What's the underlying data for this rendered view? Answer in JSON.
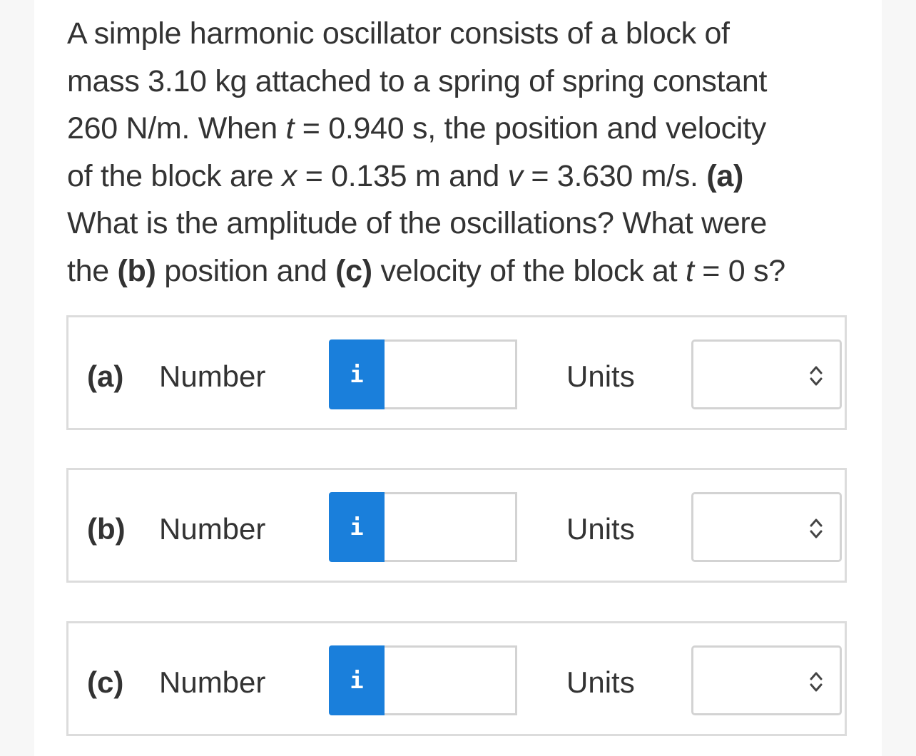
{
  "question": {
    "l1": "A simple harmonic oscillator consists of a block of",
    "l2": "mass 3.10 kg attached to a spring of spring constant",
    "l3a": "260 N/m. When ",
    "l3t": "t",
    "l3b": " = 0.940 s, the position and velocity",
    "l4a": "of the block are ",
    "l4x": "x",
    "l4b": " = 0.135 m and ",
    "l4v": "v",
    "l4c": " = 3.630 m/s. ",
    "l4d": "(a)",
    "l5": "What is the amplitude of the oscillations? What were",
    "l6a": "the ",
    "l6b": "(b)",
    "l6c": " position and ",
    "l6d": "(c)",
    "l6e": " velocity of the block at ",
    "l6t": "t",
    "l6f": " = 0 s?"
  },
  "parts": [
    {
      "letter": "(a)",
      "number_label": "Number",
      "info_icon": "i",
      "number_value": "",
      "units_label": "Units",
      "units_value": ""
    },
    {
      "letter": "(b)",
      "number_label": "Number",
      "info_icon": "i",
      "number_value": "",
      "units_label": "Units",
      "units_value": ""
    },
    {
      "letter": "(c)",
      "number_label": "Number",
      "info_icon": "i",
      "number_value": "",
      "units_label": "Units",
      "units_value": ""
    }
  ],
  "colors": {
    "info_button": "#1a7fdb",
    "border": "#dcdcdc"
  }
}
